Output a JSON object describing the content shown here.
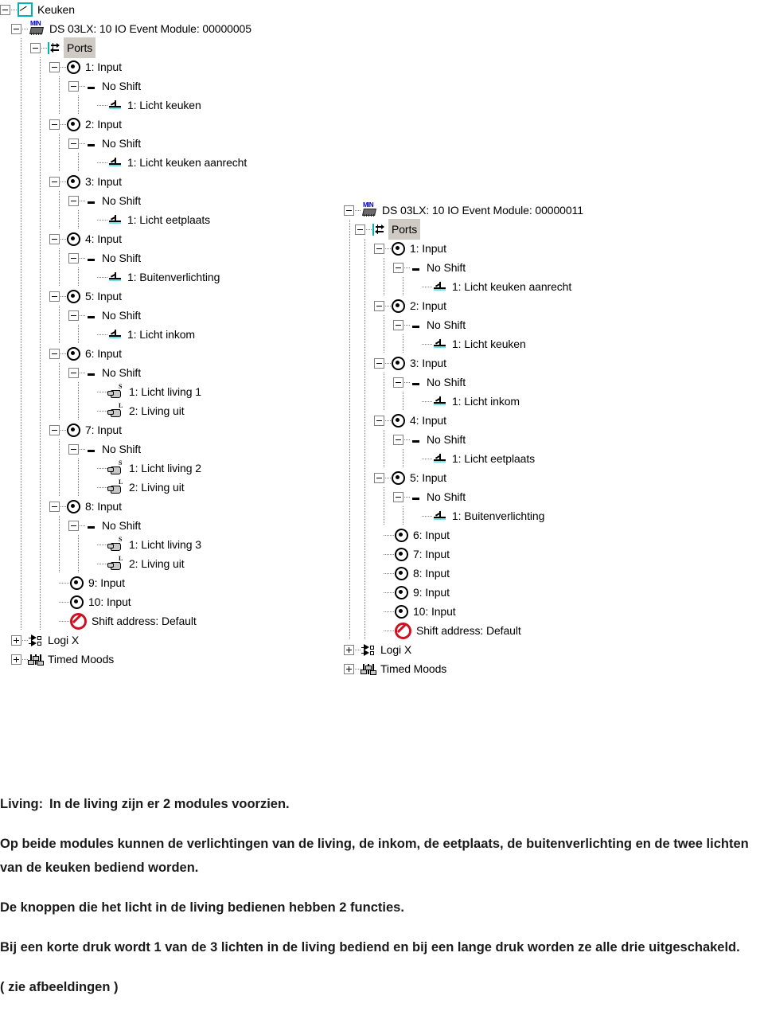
{
  "trees": {
    "left": {
      "root_label": "Keuken",
      "module_label": "DS 03LX: 10 IO Event Module: 00000005",
      "ports_label": "Ports",
      "shift_label": "No Shift",
      "shift_address_label": "Shift address: Default",
      "logix_label": "Logi X",
      "timed_moods_label": "Timed Moods",
      "ports": [
        {
          "port": "1: Input",
          "shift": "No Shift",
          "actions": [
            {
              "text": "1: Licht keuken",
              "icon": "light-icon"
            }
          ]
        },
        {
          "port": "2: Input",
          "shift": "No Shift",
          "actions": [
            {
              "text": "1: Licht keuken aanrecht",
              "icon": "light-icon"
            }
          ]
        },
        {
          "port": "3: Input",
          "shift": "No Shift",
          "actions": [
            {
              "text": "1: Licht eetplaats",
              "icon": "light-icon"
            }
          ]
        },
        {
          "port": "4: Input",
          "shift": "No Shift",
          "actions": [
            {
              "text": "1: Buitenverlichting",
              "icon": "light-icon"
            }
          ]
        },
        {
          "port": "5: Input",
          "shift": "No Shift",
          "actions": [
            {
              "text": "1: Licht inkom",
              "icon": "light-icon"
            }
          ]
        },
        {
          "port": "6: Input",
          "shift": "No Shift",
          "actions": [
            {
              "text": "1: Licht living 1",
              "icon": "hand-short-icon",
              "badge": "S"
            },
            {
              "text": "2: Living uit",
              "icon": "hand-long-icon",
              "badge": "L"
            }
          ]
        },
        {
          "port": "7: Input",
          "shift": "No Shift",
          "actions": [
            {
              "text": "1: Licht living 2",
              "icon": "hand-short-icon",
              "badge": "S"
            },
            {
              "text": "2: Living uit",
              "icon": "hand-long-icon",
              "badge": "L"
            }
          ]
        },
        {
          "port": "8: Input",
          "shift": "No Shift",
          "actions": [
            {
              "text": "1: Licht living 3",
              "icon": "hand-short-icon",
              "badge": "S"
            },
            {
              "text": "2: Living uit",
              "icon": "hand-long-icon",
              "badge": "L"
            }
          ]
        },
        {
          "port": "9: Input",
          "shift": null,
          "actions": []
        },
        {
          "port": "10: Input",
          "shift": null,
          "actions": []
        }
      ]
    },
    "right": {
      "module_label": "DS 03LX: 10 IO Event Module: 00000011",
      "ports_label": "Ports",
      "shift_address_label": "Shift address: Default",
      "logix_label": "Logi X",
      "timed_moods_label": "Timed Moods",
      "ports": [
        {
          "port": "1: Input",
          "shift": "No Shift",
          "actions": [
            {
              "text": "1: Licht keuken aanrecht",
              "icon": "light-icon"
            }
          ]
        },
        {
          "port": "2: Input",
          "shift": "No Shift",
          "actions": [
            {
              "text": "1: Licht keuken",
              "icon": "light-icon"
            }
          ]
        },
        {
          "port": "3: Input",
          "shift": "No Shift",
          "actions": [
            {
              "text": "1: Licht inkom",
              "icon": "light-icon"
            }
          ]
        },
        {
          "port": "4: Input",
          "shift": "No Shift",
          "actions": [
            {
              "text": "1: Licht eetplaats",
              "icon": "light-icon"
            }
          ]
        },
        {
          "port": "5: Input",
          "shift": "No Shift",
          "actions": [
            {
              "text": "1: Buitenverlichting",
              "icon": "light-icon"
            }
          ]
        },
        {
          "port": "6: Input",
          "shift": null,
          "actions": []
        },
        {
          "port": "7: Input",
          "shift": null,
          "actions": []
        },
        {
          "port": "8: Input",
          "shift": null,
          "actions": []
        },
        {
          "port": "9: Input",
          "shift": null,
          "actions": []
        },
        {
          "port": "10: Input",
          "shift": null,
          "actions": []
        }
      ]
    }
  },
  "document_text": {
    "intro_key": "Living:",
    "intro_value": "In de living zijn er 2 modules voorzien.",
    "paragraph_1": "Op beide modules kunnen de verlichtingen van de living, de inkom, de eetplaats, de buitenverlichting en de twee lichten van de keuken bediend worden.",
    "paragraph_2": "De knoppen die het licht in de living bedienen hebben 2 functies.",
    "paragraph_3": "Bij een korte druk wordt 1 van de 3 lichten in de living bediend en bij een lange druk worden ze alle drie uitgeschakeld.",
    "paragraph_4": "( zie afbeeldingen )"
  },
  "colors": {
    "accent_teal": "#00b3b3",
    "selection_gray": "#cfcbc4",
    "no_entry_red": "#d01020",
    "chip_blue": "#0000c0"
  }
}
